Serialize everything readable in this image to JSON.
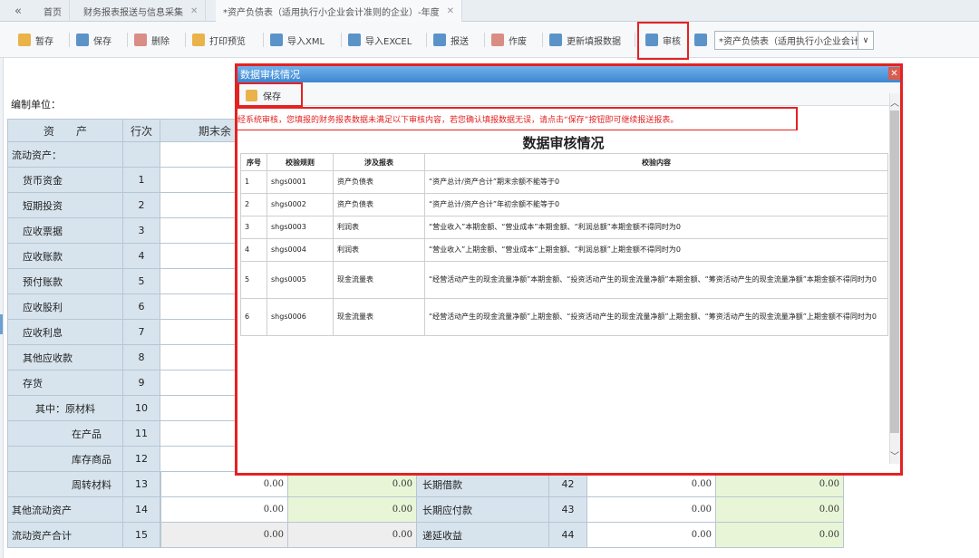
{
  "tabs": [
    {
      "label": "首页"
    },
    {
      "label": "财务报表报送与信息采集"
    },
    {
      "label": "*资产负债表（适用执行小企业会计准则的企业）-年度"
    }
  ],
  "tab_nav_glyph": "«",
  "tab_close_glyph": "✕",
  "toolbar": {
    "items": [
      {
        "label": "暂存",
        "icon": "save-draft-icon",
        "color": "#e9b34a"
      },
      {
        "label": "保存",
        "icon": "save-icon",
        "color": "#5b93c9"
      },
      {
        "label": "删除",
        "icon": "delete-icon",
        "color": "#d98d84"
      },
      {
        "label": "打印预览",
        "icon": "print-preview-icon",
        "color": "#e9b34a"
      },
      {
        "label": "导入XML",
        "icon": "import-xml-icon",
        "color": "#5b93c9"
      },
      {
        "label": "导入EXCEL",
        "icon": "import-excel-icon",
        "color": "#5b93c9"
      },
      {
        "label": "报送",
        "icon": "submit-icon",
        "color": "#5b93c9"
      },
      {
        "label": "作废",
        "icon": "void-icon",
        "color": "#d98d84"
      },
      {
        "label": "更新填报数据",
        "icon": "refresh-data-icon",
        "color": "#5b93c9"
      },
      {
        "label": "审核",
        "icon": "audit-icon",
        "color": "#5b93c9"
      }
    ],
    "report_select": "*资产负债表（适用执行小企业会计准则的企业）-年度",
    "select_arrow": "∨"
  },
  "sheet": {
    "org_label": "编制单位：",
    "header": {
      "asset": "资　　产",
      "row_no": "行次",
      "period_end": "期末余"
    },
    "rows": [
      {
        "name": "流动资产：",
        "no": "",
        "indent": 0
      },
      {
        "name": "货币资金",
        "no": "1",
        "indent": 1
      },
      {
        "name": "短期投资",
        "no": "2",
        "indent": 1
      },
      {
        "name": "应收票据",
        "no": "3",
        "indent": 1
      },
      {
        "name": "应收账款",
        "no": "4",
        "indent": 1
      },
      {
        "name": "预付账款",
        "no": "5",
        "indent": 1
      },
      {
        "name": "应收股利",
        "no": "6",
        "indent": 1
      },
      {
        "name": "应收利息",
        "no": "7",
        "indent": 1
      },
      {
        "name": "其他应收款",
        "no": "8",
        "indent": 1
      },
      {
        "name": "存货",
        "no": "9",
        "indent": 1
      },
      {
        "name": "其中：原材料",
        "no": "10",
        "indent": 2
      },
      {
        "name": "在产品",
        "no": "11",
        "indent": 3
      },
      {
        "name": "库存商品",
        "no": "12",
        "indent": 3
      },
      {
        "name": "周转材料",
        "no": "13",
        "indent": 3
      },
      {
        "name": "其他流动资产",
        "no": "14",
        "indent": 0
      },
      {
        "name": "流动资产合计",
        "no": "15",
        "indent": 0
      }
    ],
    "lower_rows": [
      {
        "v1": "0.00",
        "v2": "0.00",
        "liab": "长期借款",
        "liab_no": "42",
        "v3": "0.00",
        "v4": "0.00",
        "style": "normal"
      },
      {
        "v1": "0.00",
        "v2": "0.00",
        "liab": "长期应付款",
        "liab_no": "43",
        "v3": "0.00",
        "v4": "0.00",
        "style": "normal"
      },
      {
        "v1": "0.00",
        "v2": "0.00",
        "liab": "递延收益",
        "liab_no": "44",
        "v3": "0.00",
        "v4": "0.00",
        "style": "total"
      }
    ]
  },
  "dialog": {
    "title": "数据审核情况",
    "close_glyph": "✕",
    "save_label": "保存",
    "notice": "经系统审核，您填报的财务报表数据未满足以下审核内容，若您确认填报数据无误，请点击“保存”按钮即可继续报送报表。",
    "heading": "数据审核情况",
    "columns": [
      "序号",
      "校验规则",
      "涉及报表",
      "校验内容"
    ],
    "rows": [
      {
        "no": "1",
        "rule": "shgs0001",
        "report": "资产负债表",
        "content": "“资产总计/资产合计”期末余额不能等于0"
      },
      {
        "no": "2",
        "rule": "shgs0002",
        "report": "资产负债表",
        "content": "“资产总计/资产合计”年初余额不能等于0"
      },
      {
        "no": "3",
        "rule": "shgs0003",
        "report": "利润表",
        "content": "“营业收入”本期金额、“营业成本”本期金额、“利润总额”本期金额不得同时为0"
      },
      {
        "no": "4",
        "rule": "shgs0004",
        "report": "利润表",
        "content": "“营业收入”上期金额、“营业成本”上期金额、“利润总额”上期金额不得同时为0"
      },
      {
        "no": "5",
        "rule": "shgs0005",
        "report": "现金流量表",
        "content": "“经营活动产生的现金流量净额”本期金额、“投资活动产生的现金流量净额”本期金额、“筹资活动产生的现金流量净额”本期金额不得同时为0"
      },
      {
        "no": "6",
        "rule": "shgs0006",
        "report": "现金流量表",
        "content": "“经营活动产生的现金流量净额”上期金额、“投资活动产生的现金流量净额”上期金额、“筹资活动产生的现金流量净额”上期金额不得同时为0"
      }
    ],
    "scroll_up_glyph": "︿",
    "scroll_down_glyph": "﹀"
  }
}
